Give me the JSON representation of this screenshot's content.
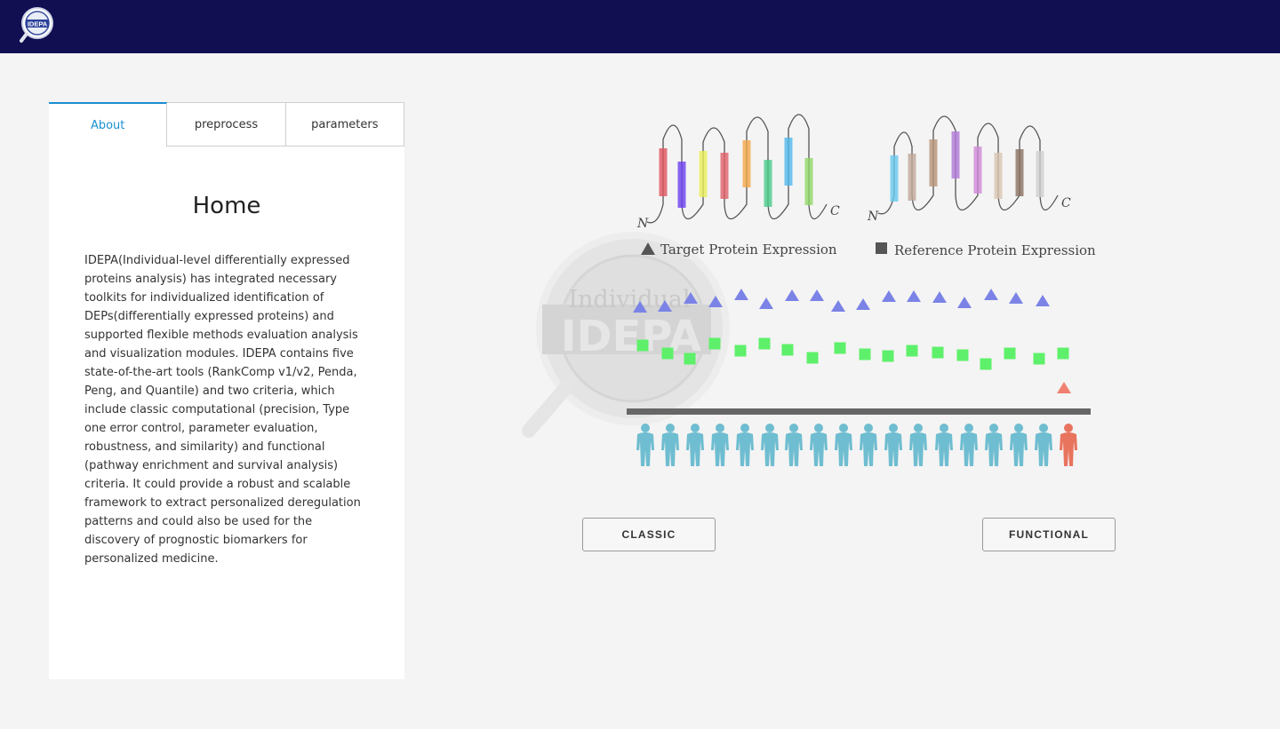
{
  "header": {
    "logo_text": "IDEPA"
  },
  "tabs": [
    {
      "label": "About",
      "active": true
    },
    {
      "label": "preprocess",
      "active": false
    },
    {
      "label": "parameters",
      "active": false
    }
  ],
  "main": {
    "title": "Home",
    "description": "IDEPA(Individual-level differentially expressed proteins analysis) has integrated necessary toolkits for individualized identification of DEPs(differentially expressed proteins) and supported flexible methods evaluation analysis and visualization modules. IDEPA contains five state-of-the-art tools (RankComp v1/v2, Penda, Peng, and Quantile) and two criteria, which include classic computational (precision, Type one error control, parameter evaluation, robustness, and similarity) and functional (pathway enrichment and survival analysis) criteria. It could provide a robust and scalable framework to extract personalized deregulation patterns and could also be used for the discovery of prognostic biomarkers for personalized medicine."
  },
  "figure": {
    "watermark_top": "Individual",
    "watermark_main": "IDEPA",
    "n_label": "N",
    "c_label": "C",
    "legend_target": "Target Protein Expression",
    "legend_reference": "Reference Protein Expression"
  },
  "buttons": {
    "classic": "CLASSIC",
    "functional": "FUNCTIONAL"
  },
  "colors": {
    "header_bg": "#110e52",
    "accent": "#1a8fd0",
    "triangle_blue": "#7b83e6",
    "square_green": "#5ef06a",
    "person_teal": "#6fbdd0",
    "person_red": "#e8745e",
    "target_triangle": "#f08070"
  }
}
